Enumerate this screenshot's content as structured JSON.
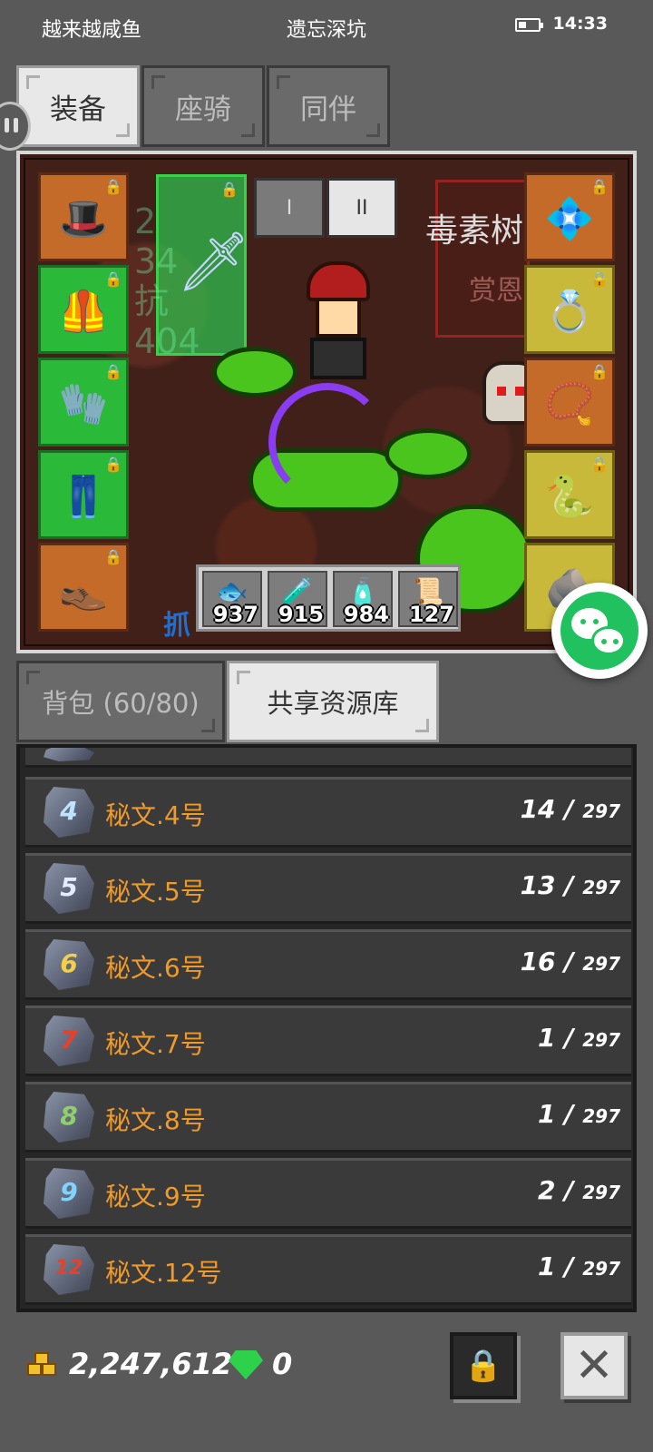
{
  "status_bar": {
    "left_text": "越来越咸鱼",
    "center_text": "遗忘深坑",
    "time": "14:33"
  },
  "top_tabs": [
    {
      "label": "装备",
      "active": true
    },
    {
      "label": "座骑",
      "active": false
    },
    {
      "label": "同伴",
      "active": false
    }
  ],
  "scene": {
    "mode_buttons": [
      "I",
      "II"
    ],
    "banner_title": "毒素树恩",
    "banner_sub": "赏恩",
    "ghost_lines": [
      "2",
      "34",
      "抗",
      "404"
    ],
    "bottom_text": "抓",
    "consumables": [
      {
        "icon": "fish-icon",
        "count": "937"
      },
      {
        "icon": "potion-icon",
        "count": "915"
      },
      {
        "icon": "potion-icon",
        "count": "984"
      },
      {
        "icon": "scroll-icon",
        "count": "127"
      }
    ]
  },
  "bag_tabs": [
    {
      "label": "背包 (60/80)",
      "active": false
    },
    {
      "label": "共享资源库",
      "active": true
    }
  ],
  "items": [
    {
      "glyph": "4",
      "glyph_color": "#bfe4ff",
      "name": "秘文.4号",
      "count": "14 / ",
      "max": "297"
    },
    {
      "glyph": "5",
      "glyph_color": "#e6ecff",
      "name": "秘文.5号",
      "count": "13 / ",
      "max": "297"
    },
    {
      "glyph": "6",
      "glyph_color": "#f2d04a",
      "name": "秘文.6号",
      "count": "16 / ",
      "max": "297"
    },
    {
      "glyph": "7",
      "glyph_color": "#e8402a",
      "name": "秘文.7号",
      "count": "1 / ",
      "max": "297"
    },
    {
      "glyph": "8",
      "glyph_color": "#8ed06a",
      "name": "秘文.8号",
      "count": "1 / ",
      "max": "297"
    },
    {
      "glyph": "9",
      "glyph_color": "#7fd4ff",
      "name": "秘文.9号",
      "count": "2 / ",
      "max": "297"
    },
    {
      "glyph": "12",
      "glyph_color": "#e8402a",
      "name": "秘文.12号",
      "count": "1 / ",
      "max": "297"
    }
  ],
  "footer": {
    "gold": "2,247,612",
    "gems": "0"
  },
  "colors": {
    "item_name": "#f09a2a",
    "slot_orange": "#c56b2a",
    "slot_green": "#2bb93a",
    "slot_yellow": "#c9b93a"
  }
}
